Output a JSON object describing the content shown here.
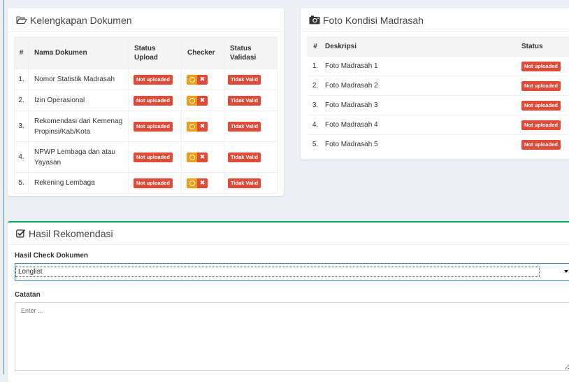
{
  "docs": {
    "title": "Kelengkapan Dokumen",
    "icon": "folder-open-icon",
    "headers": {
      "num": "#",
      "name": "Nama Dokumen",
      "upload": "Status Upload",
      "checker": "Checker",
      "validasi": "Status Validasi"
    },
    "rows": [
      {
        "num": "1.",
        "name": "Nomor Statistik Madrasah",
        "upload": "Not uploaded",
        "validasi": "Tidak Valid"
      },
      {
        "num": "2.",
        "name": "Izin Operasional",
        "upload": "Not uploaded",
        "validasi": "Tidak Valid"
      },
      {
        "num": "3.",
        "name": "Rekomendasi dari Kemenag Propinsi/Kab/Kota",
        "upload": "Not uploaded",
        "validasi": "Tidak Valid"
      },
      {
        "num": "4.",
        "name": "NPWP Lembaga dan atau Yayasan",
        "upload": "Not uploaded",
        "validasi": "Tidak Valid"
      },
      {
        "num": "5.",
        "name": "Rekening Lembaga",
        "upload": "Not uploaded",
        "validasi": "Tidak Valid"
      }
    ]
  },
  "photos": {
    "title": "Foto Kondisi Madrasah",
    "icon": "camera-icon",
    "headers": {
      "num": "#",
      "desc": "Deskripsi",
      "status": "Status"
    },
    "rows": [
      {
        "num": "1.",
        "desc": "Foto Madrasah 1",
        "status": "Not uploaded"
      },
      {
        "num": "2.",
        "desc": "Foto Madrasah 2",
        "status": "Not uploaded"
      },
      {
        "num": "3.",
        "desc": "Foto Madrasah 3",
        "status": "Not uploaded"
      },
      {
        "num": "4.",
        "desc": "Foto Madrasah 4",
        "status": "Not uploaded"
      },
      {
        "num": "5.",
        "desc": "Foto Madrasah 5",
        "status": "Not uploaded"
      }
    ]
  },
  "rekomendasi": {
    "title": "Hasil Rekomendasi",
    "icon": "check-square-icon",
    "check_label": "Hasil Check Dokumen",
    "select_value": "Longlist",
    "catatan_label": "Catatan",
    "catatan_placeholder": "Enter ..."
  },
  "colors": {
    "danger": "#dd4b39",
    "warning": "#f39c12",
    "success_border": "#00a65a",
    "primary": "#3c8dbc"
  }
}
